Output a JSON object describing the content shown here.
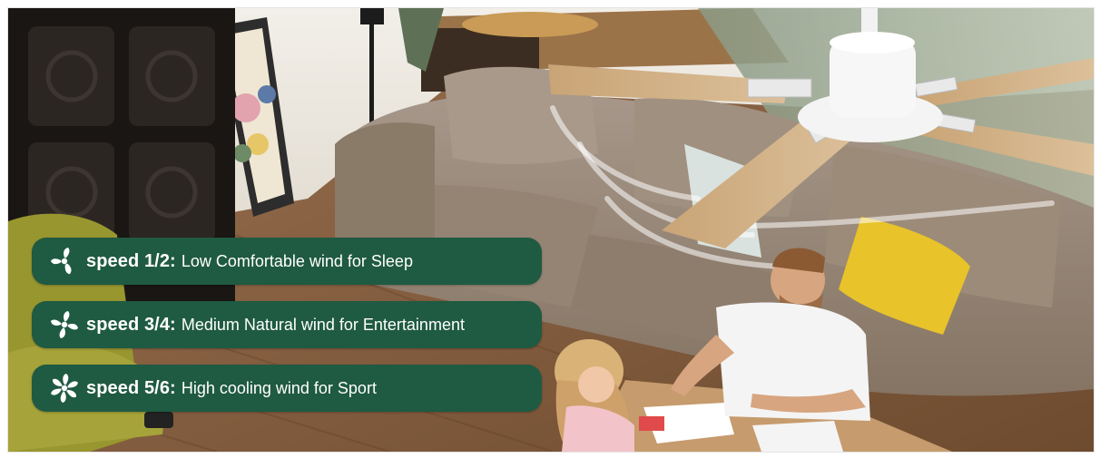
{
  "colors": {
    "badge_background": "#1f5a42",
    "badge_text": "#ffffff",
    "floor": "#8a6443",
    "sofa": "#9b8a78",
    "pillow": "#e8c32a",
    "fan_blade": "#c8a57a"
  },
  "speed_items": [
    {
      "icon": "fan-low-icon",
      "speed": "speed 1/2:",
      "description": "Low Comfortable wind for Sleep"
    },
    {
      "icon": "fan-medium-icon",
      "speed": "speed 3/4:",
      "description": "Medium Natural wind for Entertainment"
    },
    {
      "icon": "fan-high-icon",
      "speed": "speed 5/6:",
      "description": "High cooling wind for Sport"
    }
  ]
}
